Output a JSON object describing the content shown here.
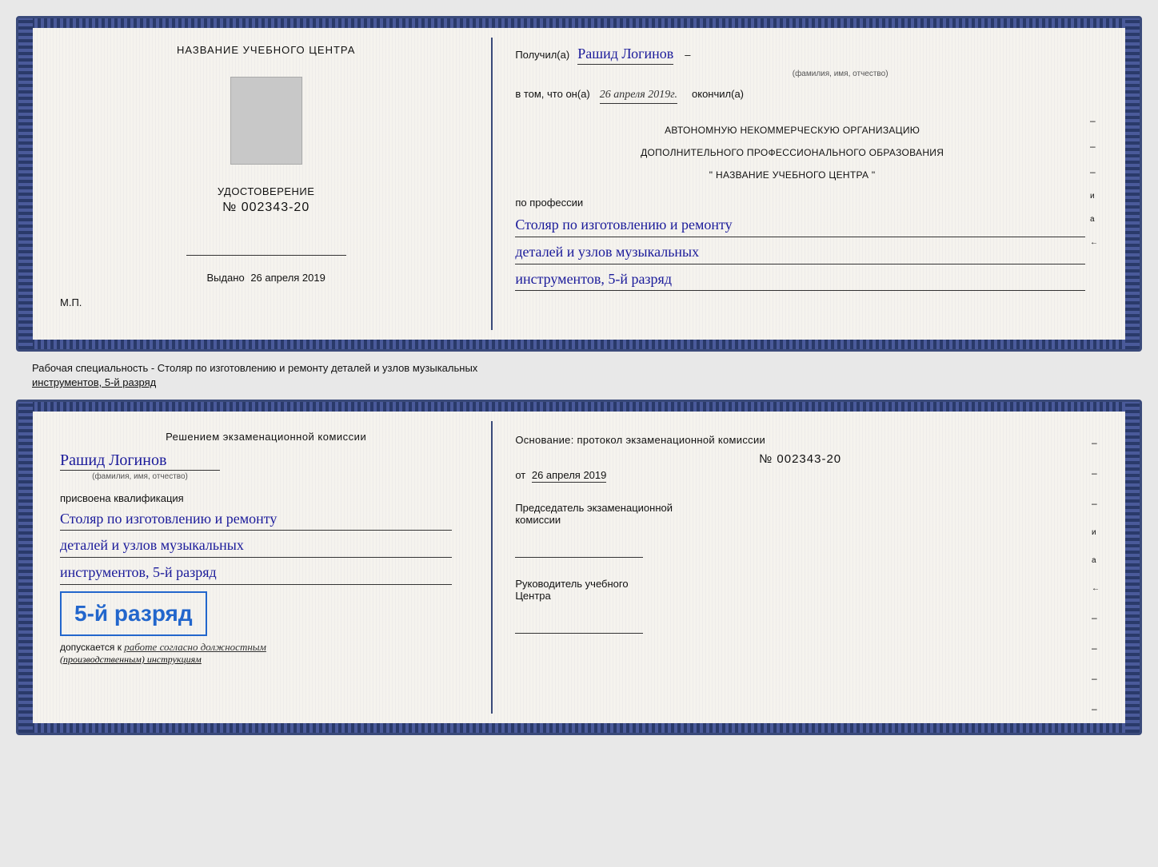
{
  "background_color": "#e8e8e8",
  "top_doc": {
    "left": {
      "center_title": "НАЗВАНИЕ УЧЕБНОГО ЦЕНТРА",
      "cert_photo_label": "фото",
      "cert_title": "УДОСТОВЕРЕНИЕ",
      "cert_number": "№ 002343-20",
      "issued_label": "Выдано",
      "issued_date": "26 апреля 2019",
      "mp_label": "М.П."
    },
    "right": {
      "received_label": "Получил(а)",
      "recipient_name": "Рашид Логинов",
      "name_sublabel": "(фамилия, имя, отчество)",
      "dash": "–",
      "vtom_label": "в том, что он(а)",
      "vtom_date": "26 апреля 2019г.",
      "okончил_label": "окончил(а)",
      "org_title_line1": "АВТОНОМНУЮ НЕКОММЕРЧЕСКУЮ ОРГАНИЗАЦИЮ",
      "org_title_line2": "ДОПОЛНИТЕЛЬНОГО ПРОФЕССИОНАЛЬНОГО ОБРАЗОВАНИЯ",
      "org_title_line3": "\"  НАЗВАНИЕ УЧЕБНОГО ЦЕНТРА   \"",
      "po_professii_label": "по профессии",
      "profession_line1": "Столяр по изготовлению и ремонту",
      "profession_line2": "деталей и узлов музыкальных",
      "profession_line3": "инструментов, 5-й разряд"
    }
  },
  "separator": {
    "text_before": "Рабочая специальность - Столяр по изготовлению и ремонту деталей и узлов музыкальных",
    "text_underline": "инструментов, 5-й разряд"
  },
  "bottom_doc": {
    "left": {
      "commission_text": "Решением экзаменационной комиссии",
      "person_name": "Рашид Логинов",
      "name_sublabel": "(фамилия, имя, отчество)",
      "prisvoena_label": "присвоена квалификация",
      "profession_line1": "Столяр по изготовлению и ремонту",
      "profession_line2": "деталей и узлов музыкальных",
      "profession_line3": "инструментов, 5-й разряд",
      "rank_bold": "5-й разряд",
      "dopuskaetsya_label": "допускается к",
      "dopuskaetsya_value": "работе согласно должностным",
      "dopuskaetsya_value2": "(производственным) инструкциям"
    },
    "right": {
      "osnov_label": "Основание: протокол экзаменационной комиссии",
      "protocol_number": "№  002343-20",
      "from_label": "от",
      "from_date": "26 апреля 2019",
      "chairman_label": "Председатель экзаменационной",
      "chairman_label2": "комиссии",
      "руководитель_label": "Руководитель учебного",
      "руководитель_label2": "Центра"
    },
    "right_dashes": [
      "–",
      "–",
      "–",
      "и",
      "а",
      "←",
      "–",
      "–",
      "–",
      "–"
    ]
  }
}
